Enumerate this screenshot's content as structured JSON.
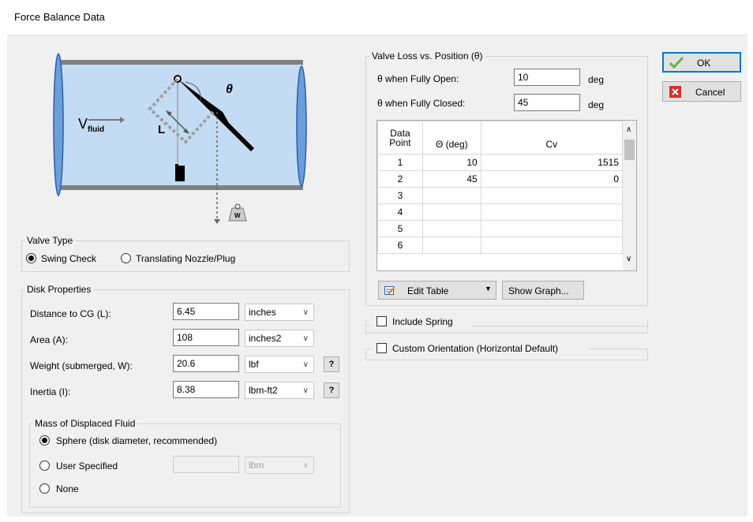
{
  "window": {
    "title": "Force Balance Data"
  },
  "diagram": {
    "v_fluid_main": "V",
    "v_fluid_sub": "fluid",
    "length_label": "L",
    "angle_label": "θ",
    "weight_label": "W"
  },
  "valve_type": {
    "legend": "Valve Type",
    "options": [
      {
        "label": "Swing Check",
        "selected": true
      },
      {
        "label": "Translating Nozzle/Plug",
        "selected": false
      }
    ]
  },
  "disk": {
    "legend": "Disk Properties",
    "rows": [
      {
        "label": "Distance to CG (L):",
        "value": "6.45",
        "unit": "inches",
        "help": false
      },
      {
        "label": "Area (A):",
        "value": "108",
        "unit": "inches2",
        "help": false
      },
      {
        "label": "Weight (submerged, W):",
        "value": "20.6",
        "unit": "lbf",
        "help": true
      },
      {
        "label": "Inertia (I):",
        "value": "8.38",
        "unit": "lbm-ft2",
        "help": true
      }
    ],
    "help_label": "?"
  },
  "mass": {
    "legend": "Mass of Displaced Fluid",
    "options": [
      {
        "label": "Sphere (disk diameter, recommended)",
        "selected": true
      },
      {
        "label": "User Specified",
        "selected": false
      },
      {
        "label": "None",
        "selected": false
      }
    ],
    "user_value": "",
    "user_unit": "lbm"
  },
  "valve_loss": {
    "legend": "Valve Loss vs. Position (θ)",
    "fully_open_label": "θ when Fully Open:",
    "fully_open_value": "10",
    "fully_closed_label": "θ when Fully Closed:",
    "fully_closed_value": "45",
    "unit": "deg",
    "table": {
      "headers": [
        "Data Point",
        "Θ (deg)",
        "Cv"
      ],
      "rows": [
        [
          "1",
          "10",
          "1515"
        ],
        [
          "2",
          "45",
          "0"
        ],
        [
          "3",
          "",
          ""
        ],
        [
          "4",
          "",
          ""
        ],
        [
          "5",
          "",
          ""
        ],
        [
          "6",
          "",
          ""
        ]
      ]
    },
    "edit_table_label": "Edit Table",
    "show_graph_label": "Show Graph..."
  },
  "include_spring": {
    "label": "Include Spring",
    "checked": false
  },
  "custom_orientation": {
    "label": "Custom Orientation (Horizontal Default)",
    "checked": false
  },
  "buttons": {
    "ok": "OK",
    "cancel": "Cancel"
  },
  "colors": {
    "accent": "#0078d7",
    "pipe_fill": "#c4dcf3",
    "ok_check": "#6ab04c",
    "cancel_red": "#d9302a"
  }
}
